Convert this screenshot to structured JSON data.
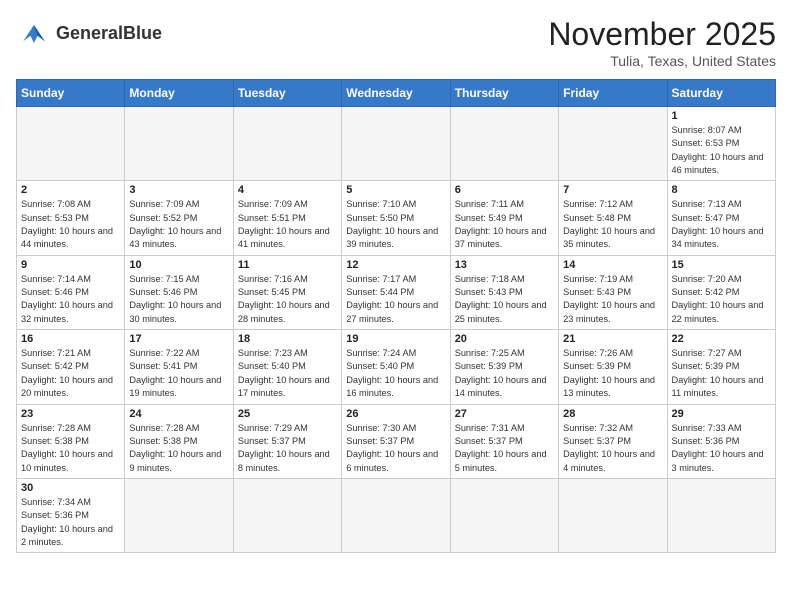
{
  "header": {
    "logo_text_normal": "General",
    "logo_text_bold": "Blue",
    "month_title": "November 2025",
    "location": "Tulia, Texas, United States"
  },
  "calendar": {
    "days_of_week": [
      "Sunday",
      "Monday",
      "Tuesday",
      "Wednesday",
      "Thursday",
      "Friday",
      "Saturday"
    ],
    "weeks": [
      [
        {
          "day": "",
          "info": ""
        },
        {
          "day": "",
          "info": ""
        },
        {
          "day": "",
          "info": ""
        },
        {
          "day": "",
          "info": ""
        },
        {
          "day": "",
          "info": ""
        },
        {
          "day": "",
          "info": ""
        },
        {
          "day": "1",
          "info": "Sunrise: 8:07 AM\nSunset: 6:53 PM\nDaylight: 10 hours\nand 46 minutes."
        }
      ],
      [
        {
          "day": "2",
          "info": "Sunrise: 7:08 AM\nSunset: 5:53 PM\nDaylight: 10 hours\nand 44 minutes."
        },
        {
          "day": "3",
          "info": "Sunrise: 7:09 AM\nSunset: 5:52 PM\nDaylight: 10 hours\nand 43 minutes."
        },
        {
          "day": "4",
          "info": "Sunrise: 7:09 AM\nSunset: 5:51 PM\nDaylight: 10 hours\nand 41 minutes."
        },
        {
          "day": "5",
          "info": "Sunrise: 7:10 AM\nSunset: 5:50 PM\nDaylight: 10 hours\nand 39 minutes."
        },
        {
          "day": "6",
          "info": "Sunrise: 7:11 AM\nSunset: 5:49 PM\nDaylight: 10 hours\nand 37 minutes."
        },
        {
          "day": "7",
          "info": "Sunrise: 7:12 AM\nSunset: 5:48 PM\nDaylight: 10 hours\nand 35 minutes."
        },
        {
          "day": "8",
          "info": "Sunrise: 7:13 AM\nSunset: 5:47 PM\nDaylight: 10 hours\nand 34 minutes."
        }
      ],
      [
        {
          "day": "9",
          "info": "Sunrise: 7:14 AM\nSunset: 5:46 PM\nDaylight: 10 hours\nand 32 minutes."
        },
        {
          "day": "10",
          "info": "Sunrise: 7:15 AM\nSunset: 5:46 PM\nDaylight: 10 hours\nand 30 minutes."
        },
        {
          "day": "11",
          "info": "Sunrise: 7:16 AM\nSunset: 5:45 PM\nDaylight: 10 hours\nand 28 minutes."
        },
        {
          "day": "12",
          "info": "Sunrise: 7:17 AM\nSunset: 5:44 PM\nDaylight: 10 hours\nand 27 minutes."
        },
        {
          "day": "13",
          "info": "Sunrise: 7:18 AM\nSunset: 5:43 PM\nDaylight: 10 hours\nand 25 minutes."
        },
        {
          "day": "14",
          "info": "Sunrise: 7:19 AM\nSunset: 5:43 PM\nDaylight: 10 hours\nand 23 minutes."
        },
        {
          "day": "15",
          "info": "Sunrise: 7:20 AM\nSunset: 5:42 PM\nDaylight: 10 hours\nand 22 minutes."
        }
      ],
      [
        {
          "day": "16",
          "info": "Sunrise: 7:21 AM\nSunset: 5:42 PM\nDaylight: 10 hours\nand 20 minutes."
        },
        {
          "day": "17",
          "info": "Sunrise: 7:22 AM\nSunset: 5:41 PM\nDaylight: 10 hours\nand 19 minutes."
        },
        {
          "day": "18",
          "info": "Sunrise: 7:23 AM\nSunset: 5:40 PM\nDaylight: 10 hours\nand 17 minutes."
        },
        {
          "day": "19",
          "info": "Sunrise: 7:24 AM\nSunset: 5:40 PM\nDaylight: 10 hours\nand 16 minutes."
        },
        {
          "day": "20",
          "info": "Sunrise: 7:25 AM\nSunset: 5:39 PM\nDaylight: 10 hours\nand 14 minutes."
        },
        {
          "day": "21",
          "info": "Sunrise: 7:26 AM\nSunset: 5:39 PM\nDaylight: 10 hours\nand 13 minutes."
        },
        {
          "day": "22",
          "info": "Sunrise: 7:27 AM\nSunset: 5:39 PM\nDaylight: 10 hours\nand 11 minutes."
        }
      ],
      [
        {
          "day": "23",
          "info": "Sunrise: 7:28 AM\nSunset: 5:38 PM\nDaylight: 10 hours\nand 10 minutes."
        },
        {
          "day": "24",
          "info": "Sunrise: 7:28 AM\nSunset: 5:38 PM\nDaylight: 10 hours\nand 9 minutes."
        },
        {
          "day": "25",
          "info": "Sunrise: 7:29 AM\nSunset: 5:37 PM\nDaylight: 10 hours\nand 8 minutes."
        },
        {
          "day": "26",
          "info": "Sunrise: 7:30 AM\nSunset: 5:37 PM\nDaylight: 10 hours\nand 6 minutes."
        },
        {
          "day": "27",
          "info": "Sunrise: 7:31 AM\nSunset: 5:37 PM\nDaylight: 10 hours\nand 5 minutes."
        },
        {
          "day": "28",
          "info": "Sunrise: 7:32 AM\nSunset: 5:37 PM\nDaylight: 10 hours\nand 4 minutes."
        },
        {
          "day": "29",
          "info": "Sunrise: 7:33 AM\nSunset: 5:36 PM\nDaylight: 10 hours\nand 3 minutes."
        }
      ],
      [
        {
          "day": "30",
          "info": "Sunrise: 7:34 AM\nSunset: 5:36 PM\nDaylight: 10 hours\nand 2 minutes."
        },
        {
          "day": "",
          "info": ""
        },
        {
          "day": "",
          "info": ""
        },
        {
          "day": "",
          "info": ""
        },
        {
          "day": "",
          "info": ""
        },
        {
          "day": "",
          "info": ""
        },
        {
          "day": "",
          "info": ""
        }
      ]
    ]
  }
}
